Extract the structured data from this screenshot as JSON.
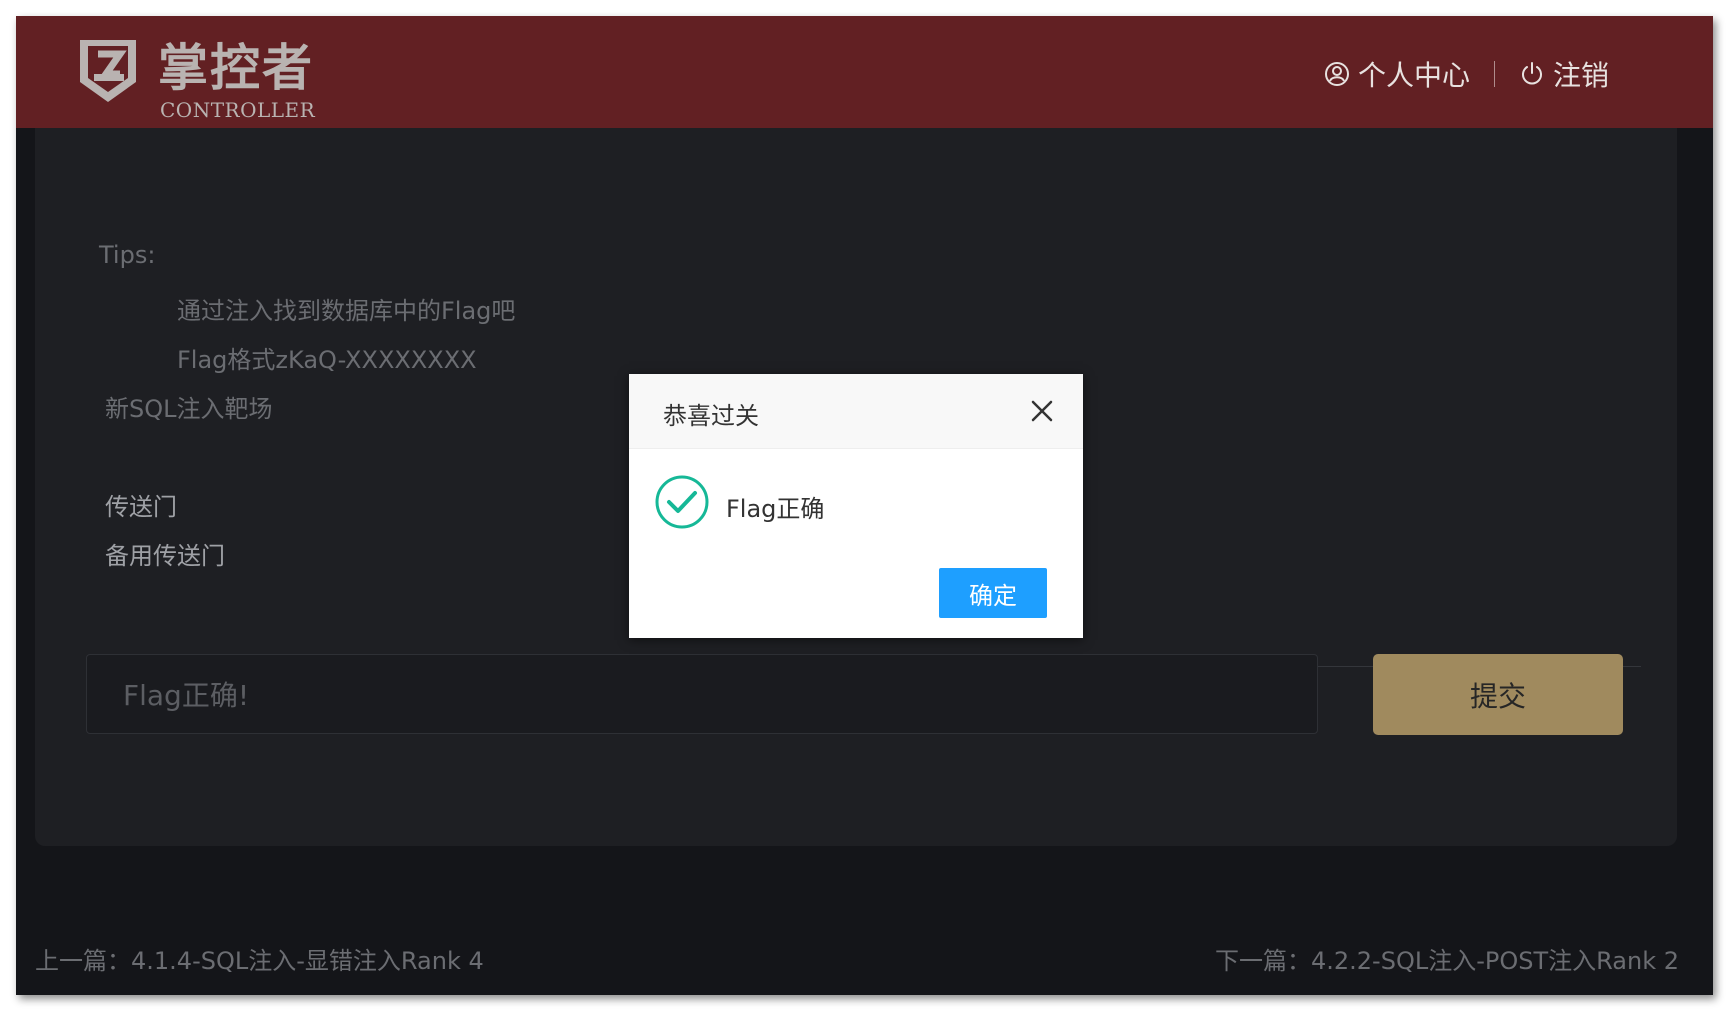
{
  "header": {
    "logo_cn": "掌控者",
    "logo_en": "CONTROLLER",
    "profile_label": "个人中心",
    "logout_label": "注销",
    "bg_color": "#622023"
  },
  "content": {
    "tips_label": "Tips:",
    "tips": [
      "通过注入找到数据库中的Flag吧",
      "Flag格式zKaQ-XXXXXXXX"
    ],
    "range_title": "新SQL注入靶场",
    "portal_label": "传送门",
    "backup_portal_label": "备用传送门"
  },
  "flag_form": {
    "input_value": "Flag正确!",
    "submit_label": "提交",
    "submit_color": "#a08a5e"
  },
  "footer": {
    "prev_label": "上一篇：4.1.4-SQL注入-显错注入Rank 4",
    "next_label": "下一篇：4.2.2-SQL注入-POST注入Rank 2"
  },
  "dialog": {
    "title": "恭喜过关",
    "message": "Flag正确",
    "ok_label": "确定",
    "ok_color": "#1e9fff",
    "icon": "check-circle-icon",
    "icon_color": "#16b897"
  }
}
